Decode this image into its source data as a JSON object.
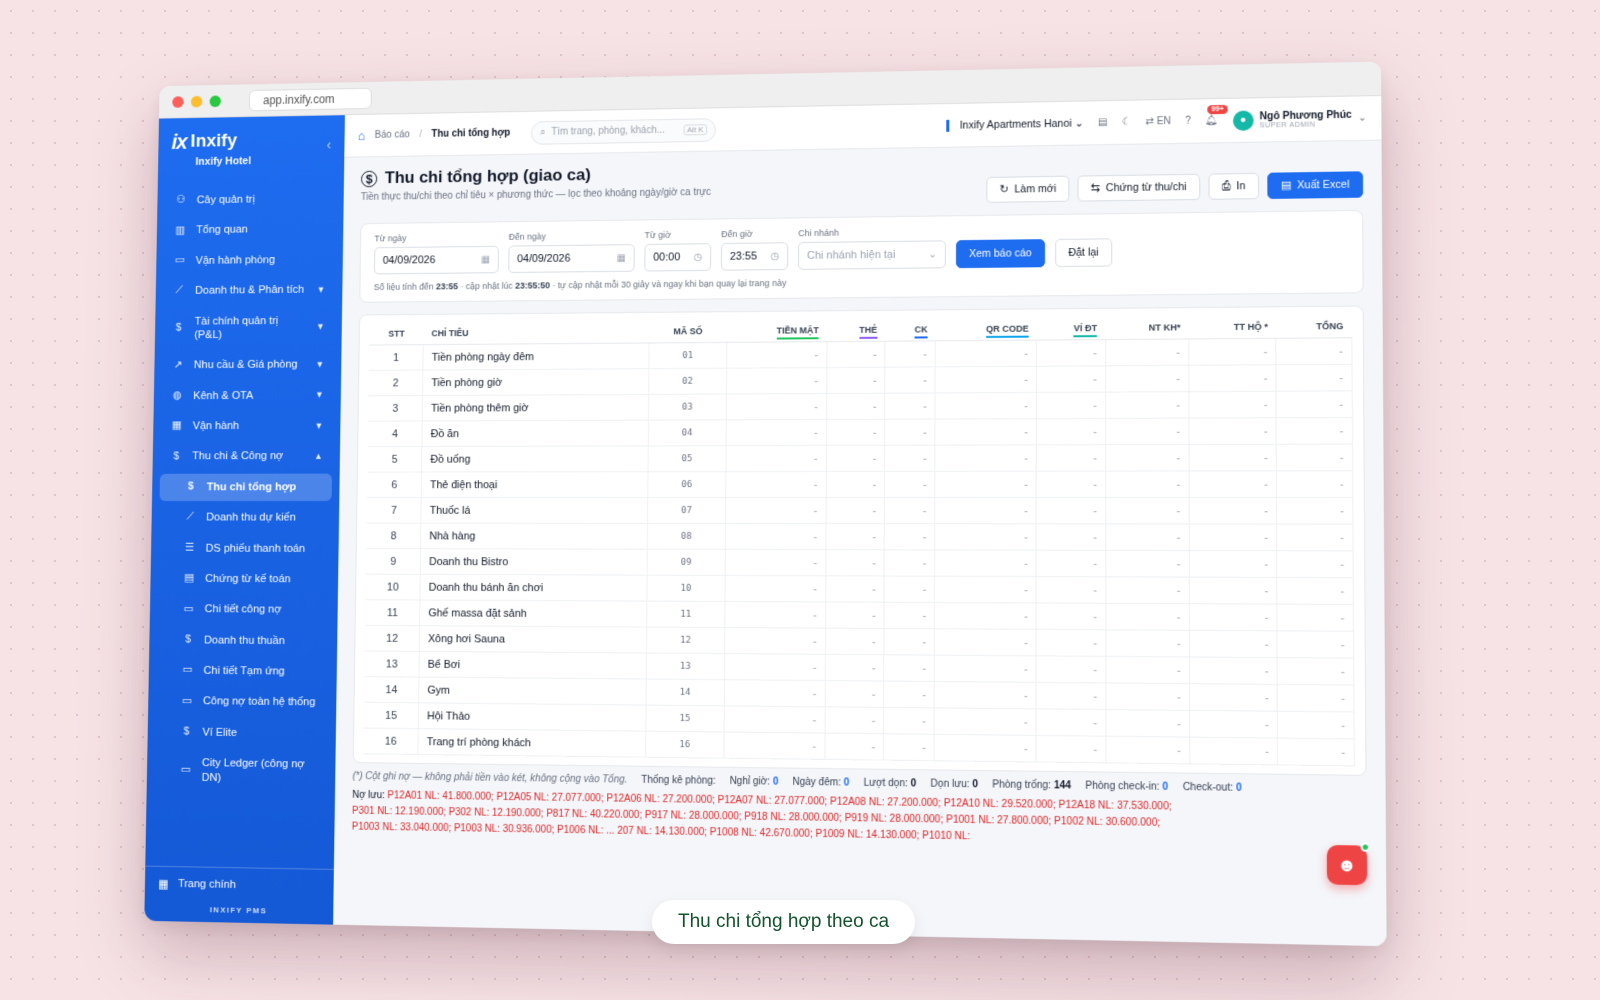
{
  "browser": {
    "url": "app.inxify.com"
  },
  "sidebar": {
    "brand_mark": "ix",
    "brand_name": "Inxify",
    "brand_sub": "Inxify Hotel",
    "items": [
      {
        "icon": "tree-icon",
        "glyph": "⚇",
        "label": "Cây quản trị",
        "has_chevron": false
      },
      {
        "icon": "bar-chart-icon",
        "glyph": "▥",
        "label": "Tổng quan",
        "has_chevron": false
      },
      {
        "icon": "monitor-icon",
        "glyph": "▭",
        "label": "Vận hành phòng",
        "has_chevron": false
      },
      {
        "icon": "line-chart-icon",
        "glyph": "⟋",
        "label": "Doanh thu & Phân tích",
        "has_chevron": true
      },
      {
        "icon": "dollar-icon",
        "glyph": "$",
        "label": "Tài chính quản trị (P&L)",
        "has_chevron": true
      },
      {
        "icon": "trend-icon",
        "glyph": "↗",
        "label": "Nhu cầu & Giá phòng",
        "has_chevron": true
      },
      {
        "icon": "globe-icon",
        "glyph": "◍",
        "label": "Kênh & OTA",
        "has_chevron": true
      },
      {
        "icon": "building-icon",
        "glyph": "▦",
        "label": "Vận hành",
        "has_chevron": true
      },
      {
        "icon": "dollar-icon",
        "glyph": "$",
        "label": "Thu chi & Công nợ",
        "has_chevron": true,
        "expanded": true
      }
    ],
    "sub_items": [
      {
        "icon": "dollar-icon",
        "glyph": "$",
        "label": "Thu chi tổng hợp",
        "active": true
      },
      {
        "icon": "line-chart-icon",
        "glyph": "⟋",
        "label": "Doanh thu dự kiến"
      },
      {
        "icon": "list-icon",
        "glyph": "☰",
        "label": "DS phiếu thanh toán"
      },
      {
        "icon": "document-icon",
        "glyph": "▤",
        "label": "Chứng từ kế toán"
      },
      {
        "icon": "card-icon",
        "glyph": "▭",
        "label": "Chi tiết công nợ"
      },
      {
        "icon": "dollar-icon",
        "glyph": "$",
        "label": "Doanh thu thuần"
      },
      {
        "icon": "card-icon",
        "glyph": "▭",
        "label": "Chi tiết Tạm ứng"
      },
      {
        "icon": "card-icon",
        "glyph": "▭",
        "label": "Công nợ toàn hệ thống"
      },
      {
        "icon": "dollar-icon",
        "glyph": "$",
        "label": "Ví Elite"
      },
      {
        "icon": "card-icon",
        "glyph": "▭",
        "label": "City Ledger (công nợ DN)"
      }
    ],
    "footer_label": "Trang chính",
    "footer_brand": "INXIFY PMS"
  },
  "topbar": {
    "breadcrumb": [
      "Báo cáo",
      "Thu chi tổng hợp"
    ],
    "search_placeholder": "Tìm trang, phòng, khách...",
    "search_shortcut": "Alt K",
    "property": "Inxify Apartments Hanoi",
    "lang": "EN",
    "notif_count": "99+",
    "user_name": "Ngô Phương Phúc",
    "user_role": "SUPER ADMIN"
  },
  "page": {
    "title": "Thu chi tổng hợp (giao ca)",
    "subtitle": "Tiền thực thu/chi theo chỉ tiêu × phương thức — lọc theo khoảng ngày/giờ ca trực",
    "actions": {
      "refresh": "Làm mới",
      "vouchers": "Chứng từ thu/chi",
      "print": "In",
      "export": "Xuất Excel"
    }
  },
  "filters": {
    "from_date_label": "Từ ngày",
    "from_date": "04/09/2026",
    "to_date_label": "Đến ngày",
    "to_date": "04/09/2026",
    "from_time_label": "Từ giờ",
    "from_time": "00:00",
    "to_time_label": "Đến giờ",
    "to_time": "23:55",
    "branch_label": "Chi nhánh",
    "branch_placeholder": "Chi nhánh hiện tại",
    "view_button": "Xem báo cáo",
    "reset_button": "Đặt lại",
    "note_prefix": "Số liệu tính đến",
    "note_time": "23:55",
    "note_mid": "· cập nhật lúc",
    "note_updated": "23:55:50",
    "note_suffix": "· tự cập nhật mỗi 30 giây và ngay khi bạn quay lại trang này"
  },
  "table": {
    "columns": [
      {
        "label": "STT",
        "align": "c",
        "underline": ""
      },
      {
        "label": "CHỈ TIÊU",
        "align": "l",
        "underline": ""
      },
      {
        "label": "MÃ SỐ",
        "align": "c",
        "underline": ""
      },
      {
        "label": "TIỀN MẶT",
        "align": "r",
        "underline": "#22c55e"
      },
      {
        "label": "THẺ",
        "align": "r",
        "underline": "#8b5cf6"
      },
      {
        "label": "CK",
        "align": "r",
        "underline": "#1e6cf0"
      },
      {
        "label": "QR CODE",
        "align": "r",
        "underline": "#0ea5e9"
      },
      {
        "label": "VÍ ĐT",
        "align": "r",
        "underline": "#14b8a6"
      },
      {
        "label": "NT KH*",
        "align": "r",
        "underline": ""
      },
      {
        "label": "TT HỘ *",
        "align": "r",
        "underline": ""
      },
      {
        "label": "TỔNG",
        "align": "r",
        "underline": ""
      }
    ],
    "rows": [
      {
        "stt": "1",
        "name": "Tiền phòng ngày đêm",
        "code": "01"
      },
      {
        "stt": "2",
        "name": "Tiền phòng giờ",
        "code": "02"
      },
      {
        "stt": "3",
        "name": "Tiền phòng thêm giờ",
        "code": "03"
      },
      {
        "stt": "4",
        "name": "Đồ ăn",
        "code": "04"
      },
      {
        "stt": "5",
        "name": "Đồ uống",
        "code": "05"
      },
      {
        "stt": "6",
        "name": "Thẻ điện thoại",
        "code": "06"
      },
      {
        "stt": "7",
        "name": "Thuốc lá",
        "code": "07"
      },
      {
        "stt": "8",
        "name": "Nhà hàng",
        "code": "08"
      },
      {
        "stt": "9",
        "name": "Doanh thu Bistro",
        "code": "09"
      },
      {
        "stt": "10",
        "name": "Doanh thu bánh ăn chơi",
        "code": "10"
      },
      {
        "stt": "11",
        "name": "Ghế massa đặt sảnh",
        "code": "11"
      },
      {
        "stt": "12",
        "name": "Xông hơi Sauna",
        "code": "12"
      },
      {
        "stt": "13",
        "name": "Bể Bơi",
        "code": "13"
      },
      {
        "stt": "14",
        "name": "Gym",
        "code": "14"
      },
      {
        "stt": "15",
        "name": "Hội Thảo",
        "code": "15"
      },
      {
        "stt": "16",
        "name": "Trang trí phòng khách",
        "code": "16"
      }
    ],
    "empty_value": "-"
  },
  "stats": {
    "footnote": "(*) Cột ghi nợ — không phải tiền vào két, không cộng vào Tổng.",
    "room_stats_label": "Thống kê phòng:",
    "hourly_label": "Nghỉ giờ:",
    "hourly": "0",
    "overnight_label": "Ngày đêm:",
    "overnight": "0",
    "cleaned_label": "Lượt dọn:",
    "cleaned": "0",
    "stay_label": "Dọn lưu:",
    "stay": "0",
    "vacant_label": "Phòng trống:",
    "vacant": "144",
    "checkin_label": "Phòng check-in:",
    "checkin": "0",
    "checkout_label": "Check-out:",
    "checkout": "0"
  },
  "debt": {
    "label": "Nợ lưu:",
    "line1": "P12A01 NL: 41.800.000; P12A05 NL: 27.077.000; P12A06 NL: 27.200.000; P12A07 NL: 27.077.000; P12A08 NL: 27.200.000; P12A10 NL: 29.520.000; P12A18 NL: 37.530.000;",
    "line2": "P301 NL: 12.190.000; P302 NL: 12.190.000; P817 NL: 40.220.000; P917 NL: 28.000.000; P918 NL: 28.000.000; P919 NL: 28.000.000; P1001 NL: 27.800.000; P1002 NL: 30.600.000;",
    "line3": "P1003 NL: 33.040.000; P1003 NL: 30.936.000; P1006 NL: ... 207 NL: 14.130.000; P1008 NL: 42.670.000; P1009 NL: 14.130.000; P1010 NL:"
  },
  "caption": "Thu chi tổng hợp theo ca"
}
